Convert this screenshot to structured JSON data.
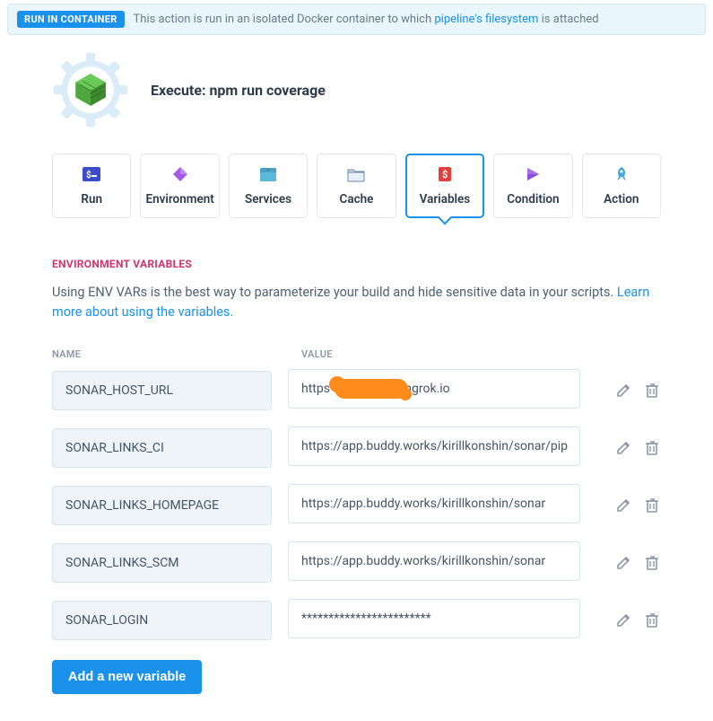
{
  "banner": {
    "badge": "RUN IN CONTAINER",
    "text_before": "This action is run in an isolated Docker container to which ",
    "link": "pipeline's filesystem",
    "text_after": " is attached"
  },
  "header": {
    "title": "Execute: npm run coverage"
  },
  "tabs": [
    {
      "id": "run",
      "label": "Run",
      "active": false
    },
    {
      "id": "environment",
      "label": "Environment",
      "active": false
    },
    {
      "id": "services",
      "label": "Services",
      "active": false
    },
    {
      "id": "cache",
      "label": "Cache",
      "active": false
    },
    {
      "id": "variables",
      "label": "Variables",
      "active": true
    },
    {
      "id": "condition",
      "label": "Condition",
      "active": false
    },
    {
      "id": "action",
      "label": "Action",
      "active": false
    }
  ],
  "section": {
    "label": "ENVIRONMENT VARIABLES",
    "desc_before": "Using ENV VARs is the best way to parameterize your build and hide sensitive data in your scripts. ",
    "desc_link": "Learn more about using the variables."
  },
  "columns": {
    "name": "NAME",
    "value": "VALUE"
  },
  "variables": [
    {
      "name": "SONAR_HOST_URL",
      "value": "https                        ngrok.io",
      "redacted": true
    },
    {
      "name": "SONAR_LINKS_CI",
      "value": "https://app.buddy.works/kirillkonshin/sonar/pip",
      "redacted": false
    },
    {
      "name": "SONAR_LINKS_HOMEPAGE",
      "value": "https://app.buddy.works/kirillkonshin/sonar",
      "redacted": false
    },
    {
      "name": "SONAR_LINKS_SCM",
      "value": "https://app.buddy.works/kirillkonshin/sonar",
      "redacted": false
    },
    {
      "name": "SONAR_LOGIN",
      "value": "************************",
      "redacted": false
    }
  ],
  "add_button": "Add a new variable"
}
